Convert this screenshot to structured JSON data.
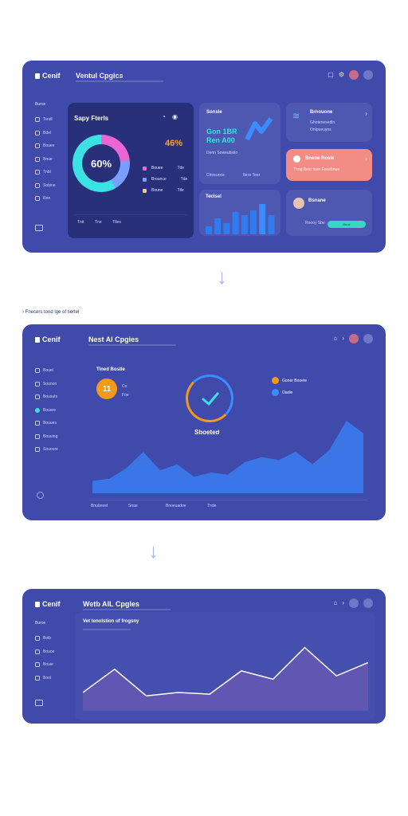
{
  "panel1": {
    "logo": "Cenif",
    "title": "Ventul Cpgics",
    "sidebar": {
      "heading": "Buroe",
      "items": [
        "Tsndl",
        "Bdel",
        "Bouee",
        "Boue",
        "Tnbl",
        "Sobine",
        "Ren"
      ]
    },
    "donut_card": {
      "title": "Sapy Fterls",
      "center_value": "60%",
      "badge": "46%",
      "legend": [
        {
          "label": "Bouee",
          "value": "Tde",
          "color": "#ec66d3"
        },
        {
          "label": "Brounce",
          "value": "Tde",
          "color": "#7aa0ff"
        },
        {
          "label": "Boune",
          "value": "Ttle",
          "color": "#f7d14a"
        }
      ],
      "footer": [
        "Tnit",
        "Tne",
        "Ttles"
      ]
    },
    "metric_card": {
      "title": "Sonsle",
      "line1": "Gon 1BR",
      "line2": "Ren A00",
      "caption": "Denn Soweubstio",
      "foot1": "Clnreunce",
      "foot2": "Ibrre Teer"
    },
    "bar_card": {
      "title": "Teclsel"
    },
    "notify_card": {
      "title": "Brnouone",
      "rows": [
        "Ghotenesedin",
        "Onlpueuyns"
      ]
    },
    "coral_card": {
      "title": "Bneoe Rosle",
      "text": "Thng Beto fooe Fooebnue"
    },
    "profile_card": {
      "title": "Bsnane",
      "sub": "Roooy Sbe",
      "button": "Bnoe"
    }
  },
  "divider_caption": "Fnecers tond lge of tiertel",
  "panel2": {
    "logo": "Cenif",
    "title": "Nest AI Cpgies",
    "sidebar": {
      "items": [
        "Bouel",
        "Sounon",
        "Bousuts",
        "Bouare",
        "Bouues",
        "Bouuing",
        "Souoore"
      ]
    },
    "task": {
      "title": "Tined Bostle",
      "number": "11",
      "lines": [
        "Co",
        "Foe"
      ]
    },
    "status_label": "Sboeted",
    "legend": [
      {
        "label": "Goner Booete",
        "color": "#f49a1a"
      },
      {
        "label": "Oarlie",
        "color": "#3b8cff"
      }
    ],
    "footer": [
      "Bnubneel",
      "Snae",
      "Bnoeuadoe",
      "Tnde"
    ],
    "chart_data": {
      "type": "area",
      "x": [
        1,
        2,
        3,
        4,
        5,
        6,
        7,
        8,
        9,
        10,
        11,
        12,
        13,
        14,
        15,
        16,
        17
      ],
      "values": [
        12,
        14,
        24,
        40,
        22,
        28,
        16,
        20,
        18,
        30,
        35,
        32,
        40,
        28,
        42,
        70,
        58
      ],
      "ylim": [
        0,
        80
      ]
    }
  },
  "panel3": {
    "logo": "Cenif",
    "title": "Wetb AIL Cpgles",
    "sidebar": {
      "heading": "Buroe",
      "items": [
        "Boib",
        "Bouoe",
        "Bouie",
        "Bool"
      ]
    },
    "chart_title": "Vet tenolstion uf frogsny",
    "chart_data": {
      "type": "area",
      "x": [
        1,
        2,
        3,
        4,
        5,
        6,
        7,
        8,
        9,
        10
      ],
      "values": [
        22,
        50,
        18,
        22,
        20,
        48,
        38,
        76,
        42,
        58
      ],
      "ylim": [
        0,
        90
      ]
    }
  }
}
